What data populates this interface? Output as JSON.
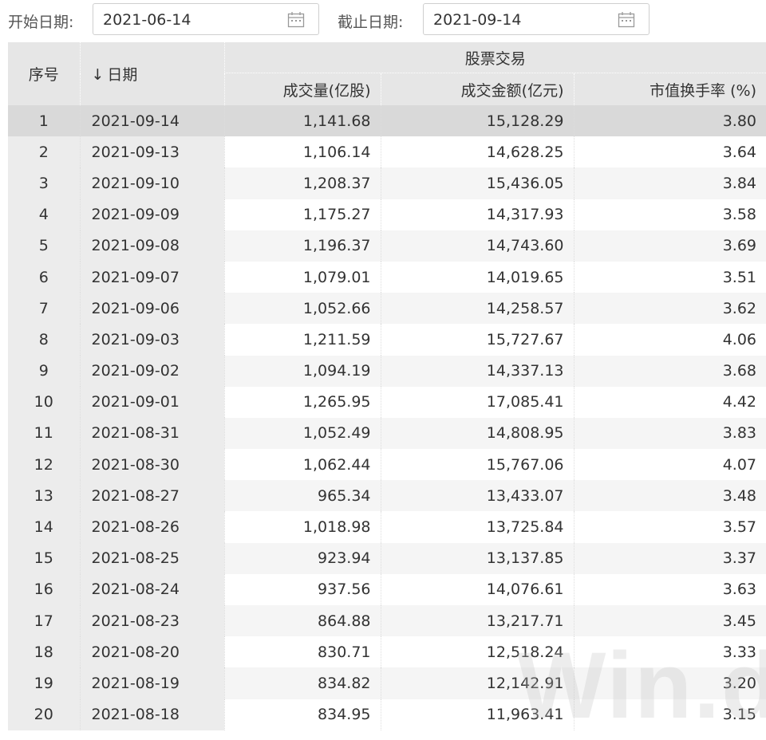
{
  "filters": {
    "start_label": "开始日期:",
    "start_value": "2021-06-14",
    "end_label": "截止日期:",
    "end_value": "2021-09-14"
  },
  "table": {
    "headers": {
      "index": "序号",
      "date_sort_icon": "arrow-down-icon",
      "date_sort_glyph": "↓",
      "date": "日期",
      "group": "股票交易",
      "volume": "成交量(亿股)",
      "amount": "成交金额(亿元)",
      "turnover": "市值换手率 (%)"
    },
    "rows": [
      {
        "index": "1",
        "date": "2021-09-14",
        "volume": "1,141.68",
        "amount": "15,128.29",
        "turnover": "3.80"
      },
      {
        "index": "2",
        "date": "2021-09-13",
        "volume": "1,106.14",
        "amount": "14,628.25",
        "turnover": "3.64"
      },
      {
        "index": "3",
        "date": "2021-09-10",
        "volume": "1,208.37",
        "amount": "15,436.05",
        "turnover": "3.84"
      },
      {
        "index": "4",
        "date": "2021-09-09",
        "volume": "1,175.27",
        "amount": "14,317.93",
        "turnover": "3.58"
      },
      {
        "index": "5",
        "date": "2021-09-08",
        "volume": "1,196.37",
        "amount": "14,743.60",
        "turnover": "3.69"
      },
      {
        "index": "6",
        "date": "2021-09-07",
        "volume": "1,079.01",
        "amount": "14,019.65",
        "turnover": "3.51"
      },
      {
        "index": "7",
        "date": "2021-09-06",
        "volume": "1,052.66",
        "amount": "14,258.57",
        "turnover": "3.62"
      },
      {
        "index": "8",
        "date": "2021-09-03",
        "volume": "1,211.59",
        "amount": "15,727.67",
        "turnover": "4.06"
      },
      {
        "index": "9",
        "date": "2021-09-02",
        "volume": "1,094.19",
        "amount": "14,337.13",
        "turnover": "3.68"
      },
      {
        "index": "10",
        "date": "2021-09-01",
        "volume": "1,265.95",
        "amount": "17,085.41",
        "turnover": "4.42"
      },
      {
        "index": "11",
        "date": "2021-08-31",
        "volume": "1,052.49",
        "amount": "14,808.95",
        "turnover": "3.83"
      },
      {
        "index": "12",
        "date": "2021-08-30",
        "volume": "1,062.44",
        "amount": "15,767.06",
        "turnover": "4.07"
      },
      {
        "index": "13",
        "date": "2021-08-27",
        "volume": "965.34",
        "amount": "13,433.07",
        "turnover": "3.48"
      },
      {
        "index": "14",
        "date": "2021-08-26",
        "volume": "1,018.98",
        "amount": "13,725.84",
        "turnover": "3.57"
      },
      {
        "index": "15",
        "date": "2021-08-25",
        "volume": "923.94",
        "amount": "13,137.85",
        "turnover": "3.37"
      },
      {
        "index": "16",
        "date": "2021-08-24",
        "volume": "937.56",
        "amount": "14,076.61",
        "turnover": "3.63"
      },
      {
        "index": "17",
        "date": "2021-08-23",
        "volume": "864.88",
        "amount": "13,217.71",
        "turnover": "3.45"
      },
      {
        "index": "18",
        "date": "2021-08-20",
        "volume": "830.71",
        "amount": "12,518.24",
        "turnover": "3.33"
      },
      {
        "index": "19",
        "date": "2021-08-19",
        "volume": "834.82",
        "amount": "12,142.91",
        "turnover": "3.20"
      },
      {
        "index": "20",
        "date": "2021-08-18",
        "volume": "834.95",
        "amount": "11,963.41",
        "turnover": "3.15"
      }
    ]
  },
  "watermark": "Win.d",
  "icons": {
    "calendar": "calendar-icon"
  },
  "colors": {
    "header_bg": "#e6e6e6",
    "selected_row_bg": "#d9d9d9",
    "alt_row_bg": "#f5f5f5"
  }
}
